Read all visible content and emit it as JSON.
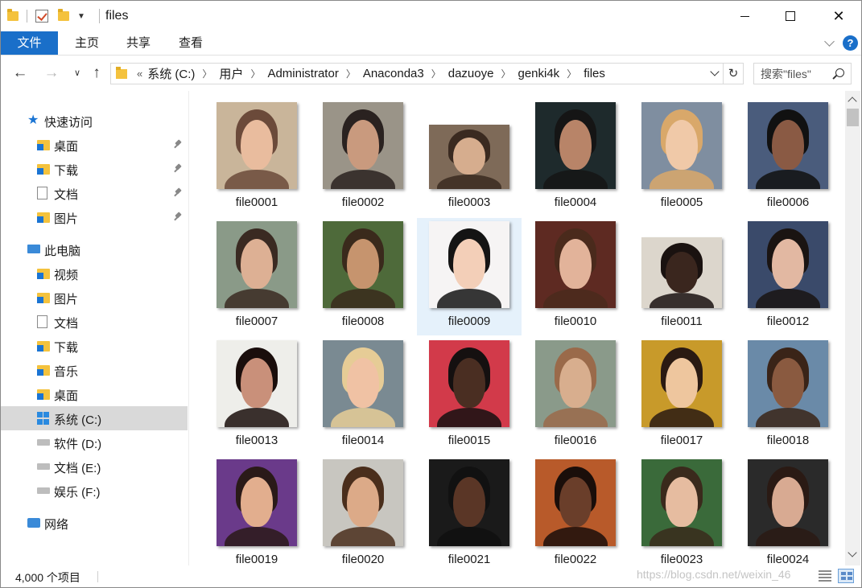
{
  "window": {
    "title": "files"
  },
  "ribbon": {
    "tabs": [
      {
        "label": "文件"
      },
      {
        "label": "主页"
      },
      {
        "label": "共享"
      },
      {
        "label": "查看"
      }
    ],
    "help_label": "?"
  },
  "address": {
    "more": "«",
    "crumbs": [
      "系统 (C:)",
      "用户",
      "Administrator",
      "Anaconda3",
      "dazuoye",
      "genki4k",
      "files"
    ],
    "search_placeholder": "搜索\"files\""
  },
  "sidebar": {
    "items": [
      {
        "label": "快速访问",
        "icon": "star-icon",
        "pinned": false
      },
      {
        "label": "桌面",
        "icon": "desktop-folder-icon",
        "pinned": true
      },
      {
        "label": "下载",
        "icon": "download-folder-icon",
        "pinned": true
      },
      {
        "label": "文档",
        "icon": "document-icon",
        "pinned": true
      },
      {
        "label": "图片",
        "icon": "pictures-folder-icon",
        "pinned": true
      },
      {
        "label": "此电脑",
        "icon": "this-pc-icon",
        "pinned": false
      },
      {
        "label": "视频",
        "icon": "videos-folder-icon",
        "pinned": false
      },
      {
        "label": "图片",
        "icon": "pictures-folder-icon",
        "pinned": false
      },
      {
        "label": "文档",
        "icon": "document-icon",
        "pinned": false
      },
      {
        "label": "下载",
        "icon": "download-folder-icon",
        "pinned": false
      },
      {
        "label": "音乐",
        "icon": "music-folder-icon",
        "pinned": false
      },
      {
        "label": "桌面",
        "icon": "desktop-folder-icon",
        "pinned": false
      },
      {
        "label": "系统 (C:)",
        "icon": "windows-drive-icon",
        "pinned": false,
        "selected": true
      },
      {
        "label": "软件 (D:)",
        "icon": "drive-icon",
        "pinned": false
      },
      {
        "label": "文档 (E:)",
        "icon": "drive-icon",
        "pinned": false
      },
      {
        "label": "娱乐 (F:)",
        "icon": "drive-icon",
        "pinned": false
      },
      {
        "label": "网络",
        "icon": "network-icon",
        "pinned": false
      }
    ]
  },
  "files": [
    {
      "name": "file0001",
      "bg": "#c9b59a",
      "skin": "#e9bc9e",
      "hair": "#6b4a3a"
    },
    {
      "name": "file0002",
      "bg": "#9a9488",
      "skin": "#c99a7e",
      "hair": "#2a2220"
    },
    {
      "name": "file0003",
      "bg": "#7e6a58",
      "skin": "#d6ad8e",
      "hair": "#3a2a20"
    },
    {
      "name": "file0004",
      "bg": "#1e2a2c",
      "skin": "#b88468",
      "hair": "#151515"
    },
    {
      "name": "file0005",
      "bg": "#7f8ea0",
      "skin": "#f0c9a8",
      "hair": "#d9a86a"
    },
    {
      "name": "file0006",
      "bg": "#4a5c7c",
      "skin": "#8a5a44",
      "hair": "#111111"
    },
    {
      "name": "file0007",
      "bg": "#8a9a88",
      "skin": "#ddb094",
      "hair": "#3a2a22"
    },
    {
      "name": "file0008",
      "bg": "#4e6a3a",
      "skin": "#c6946e",
      "hair": "#3a2a1c"
    },
    {
      "name": "file0009",
      "bg": "#f6f4f4",
      "skin": "#f3cfb8",
      "hair": "#141414",
      "selected": true
    },
    {
      "name": "file0010",
      "bg": "#5e2a22",
      "skin": "#e2b39a",
      "hair": "#4a2a1c"
    },
    {
      "name": "file0011",
      "bg": "#dcd6cc",
      "skin": "#3a261e",
      "hair": "#1a1210"
    },
    {
      "name": "file0012",
      "bg": "#3a4a6a",
      "skin": "#e2b8a2",
      "hair": "#1a1412"
    },
    {
      "name": "file0013",
      "bg": "#eeeeea",
      "skin": "#c9907a",
      "hair": "#1a0e0c"
    },
    {
      "name": "file0014",
      "bg": "#7a8a92",
      "skin": "#f0c2a4",
      "hair": "#e6cc96"
    },
    {
      "name": "file0015",
      "bg": "#d23a4a",
      "skin": "#4a2e22",
      "hair": "#151010"
    },
    {
      "name": "file0016",
      "bg": "#8a9a8a",
      "skin": "#d8ae8e",
      "hair": "#9a6a4a"
    },
    {
      "name": "file0017",
      "bg": "#c89a2a",
      "skin": "#eec69e",
      "hair": "#2a1a12"
    },
    {
      "name": "file0018",
      "bg": "#6a8aa8",
      "skin": "#8a5a40",
      "hair": "#3a2418"
    },
    {
      "name": "file0019",
      "bg": "#6a3a8a",
      "skin": "#e2ae8e",
      "hair": "#2a1a18"
    },
    {
      "name": "file0020",
      "bg": "#c8c6c0",
      "skin": "#dcaa88",
      "hair": "#4a2e1c"
    },
    {
      "name": "file0021",
      "bg": "#1a1a1a",
      "skin": "#5a3626",
      "hair": "#111111"
    },
    {
      "name": "file0022",
      "bg": "#b85a2a",
      "skin": "#6a3e2a",
      "hair": "#1a0e0a"
    },
    {
      "name": "file0023",
      "bg": "#3a6a3a",
      "skin": "#e6bca0",
      "hair": "#3a2a1c"
    },
    {
      "name": "file0024",
      "bg": "#2a2a2a",
      "skin": "#d8aa92",
      "hair": "#2a1a14"
    }
  ],
  "status": {
    "count": "4,000 个项目",
    "watermark": "https://blog.csdn.net/weixin_46"
  },
  "colors": {
    "accent": "#1a6fc9",
    "selected_tile": "#e5f1fb",
    "selected_nav": "#d9d9d9"
  }
}
